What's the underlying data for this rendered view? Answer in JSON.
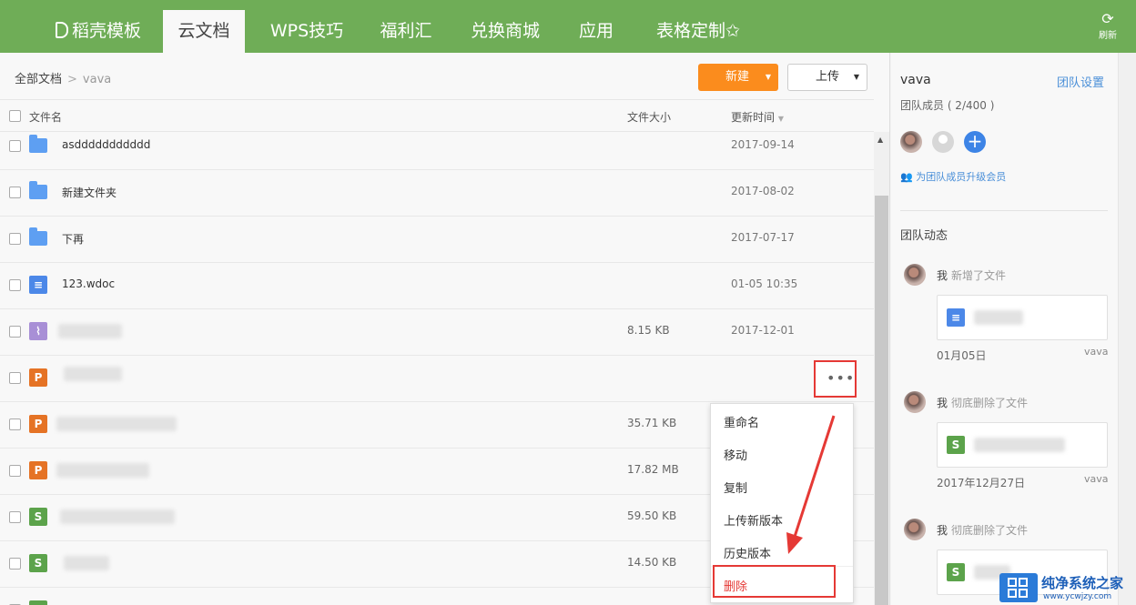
{
  "topnav": {
    "tabs": [
      {
        "label": "稻壳模板",
        "active": false
      },
      {
        "label": "云文档",
        "active": true
      },
      {
        "label": "WPS技巧",
        "active": false
      },
      {
        "label": "福利汇",
        "active": false
      },
      {
        "label": "兑换商城",
        "active": false
      },
      {
        "label": "应用",
        "active": false
      },
      {
        "label": "表格定制✩",
        "active": false
      }
    ],
    "refresh_label": "刷新",
    "refresh_icon": "refresh-icon",
    "accent": "#6fad57"
  },
  "breadcrumb": {
    "root": "全部文档",
    "sep": ">",
    "current": "vava"
  },
  "toolbar": {
    "new_label": "新建",
    "upload_label": "上传",
    "new_color": "#fb8c1d"
  },
  "table": {
    "headers": {
      "name": "文件名",
      "size": "文件大小",
      "updated": "更新时间"
    },
    "rows": [
      {
        "type": "folder",
        "name": "asddddddddddd",
        "size": "",
        "date": "2017-09-14"
      },
      {
        "type": "folder",
        "name": "新建文件夹",
        "size": "",
        "date": "2017-08-02"
      },
      {
        "type": "folder",
        "name": "下再",
        "size": "",
        "date": "2017-07-17"
      },
      {
        "type": "doc",
        "name": "123.wdoc",
        "size": "",
        "date": "01-05 10:35"
      },
      {
        "type": "img",
        "name": "",
        "size": "8.15 KB",
        "date": "2017-12-01"
      },
      {
        "type": "ppt",
        "name": "",
        "size": "",
        "date": ""
      },
      {
        "type": "ppt",
        "name": "",
        "size": "35.71 KB",
        "date": ""
      },
      {
        "type": "ppt",
        "name": "",
        "size": "17.82 MB",
        "date": ""
      },
      {
        "type": "xls",
        "name": "",
        "size": "59.50 KB",
        "date": ""
      },
      {
        "type": "xls",
        "name": "",
        "size": "14.50 KB",
        "date": ""
      }
    ]
  },
  "more_button": {
    "label": "•••"
  },
  "context_menu": {
    "items": [
      "重命名",
      "移动",
      "复制",
      "上传新版本",
      "历史版本"
    ],
    "delete_label": "删除",
    "delete_color": "#e53935"
  },
  "side": {
    "team_name": "vava",
    "settings_label": "团队设置",
    "members_label": "团队成员 ( 2/400 )",
    "upgrade_label": "为团队成员升级会员",
    "dynamics_title": "团队动态",
    "activities": [
      {
        "actor": "我",
        "action": "新增了文件",
        "file_type": "doc",
        "date": "01月05日",
        "user": "vava"
      },
      {
        "actor": "我",
        "action": "彻底删除了文件",
        "file_type": "xls",
        "date": "2017年12月27日",
        "user": "vava"
      },
      {
        "actor": "我",
        "action": "彻底删除了文件",
        "file_type": "xls",
        "date": "",
        "user": ""
      }
    ]
  },
  "watermark": {
    "line1": "纯净系统之家",
    "line2": "www.ycwjzy.com"
  }
}
